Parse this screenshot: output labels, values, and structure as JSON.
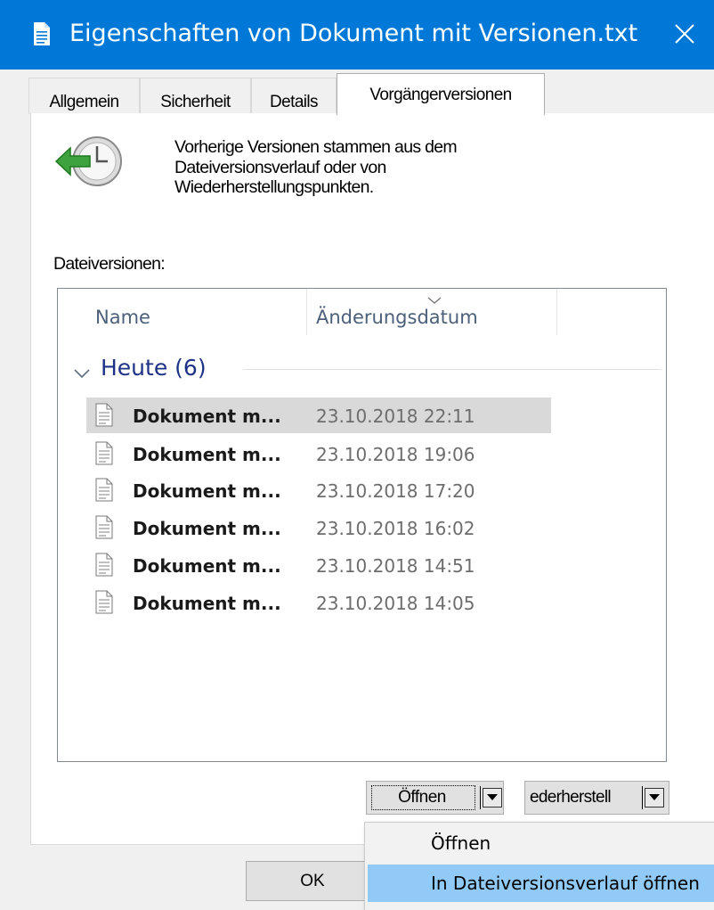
{
  "window": {
    "title": "Eigenschaften von Dokument mit Versionen.txt",
    "accent": "#0078d7"
  },
  "tabs": [
    {
      "label": "Allgemein"
    },
    {
      "label": "Sicherheit"
    },
    {
      "label": "Details"
    },
    {
      "label": "Vorgängerversionen",
      "active": true
    }
  ],
  "info": {
    "icon": "restore-clock-icon",
    "text": "Vorherige Versionen stammen aus dem Dateiversionsverlauf oder von Wiederherstellungspunkten."
  },
  "versions": {
    "label": "Dateiversionen:",
    "columns": [
      "Name",
      "Änderungsdatum"
    ],
    "group": "Heute (6)",
    "rows": [
      {
        "name": "Dokument m...",
        "date": "23.10.2018 22:11",
        "selected": true
      },
      {
        "name": "Dokument m...",
        "date": "23.10.2018 19:06"
      },
      {
        "name": "Dokument m...",
        "date": "23.10.2018 17:20"
      },
      {
        "name": "Dokument m...",
        "date": "23.10.2018 16:02"
      },
      {
        "name": "Dokument m...",
        "date": "23.10.2018 14:51"
      },
      {
        "name": "Dokument m...",
        "date": "23.10.2018 14:05"
      }
    ]
  },
  "buttons": {
    "open": "Öffnen",
    "restore": "ederherstell",
    "ok": "OK"
  },
  "menu": {
    "items": [
      {
        "label": "Öffnen"
      },
      {
        "label": "In Dateiversionsverlauf öffnen",
        "highlighted": true
      }
    ]
  }
}
